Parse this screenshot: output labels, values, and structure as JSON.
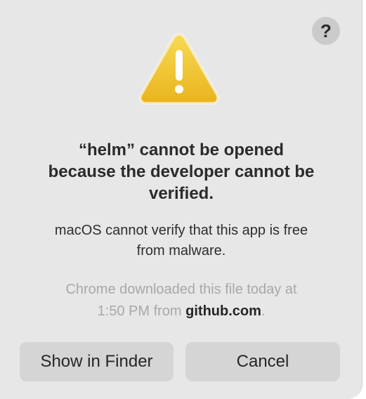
{
  "dialog": {
    "help_label": "?",
    "icon": "warning-triangle-icon",
    "title_lines": [
      "“helm” cannot be opened",
      "because the developer cannot be",
      "verified."
    ],
    "message_lines": [
      "macOS cannot verify that this app is free",
      "from malware."
    ],
    "source": {
      "line1": "Chrome downloaded this file today at",
      "line2_prefix": "1:50 PM from ",
      "domain": "github.com",
      "line2_suffix": "."
    },
    "buttons": {
      "show_in_finder": "Show in Finder",
      "cancel": "Cancel"
    }
  },
  "colors": {
    "dialog_background": "#e7e7e7",
    "button_background": "#d5d5d5",
    "warning_yellow": "#f1c52f",
    "secondary_text": "#a8a8a8"
  }
}
